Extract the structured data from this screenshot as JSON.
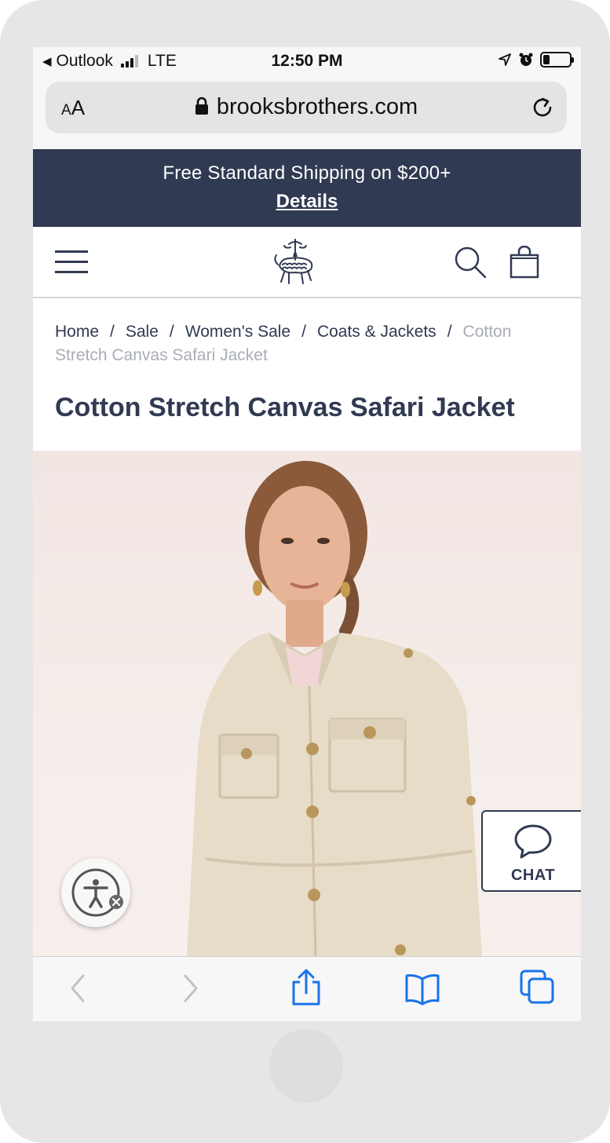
{
  "status_bar": {
    "back_app": "Outlook",
    "network": "LTE",
    "time": "12:50 PM",
    "battery_level": 0.25
  },
  "url_bar": {
    "text_size_label_small": "A",
    "text_size_label_large": "A",
    "domain": "brooksbrothers.com"
  },
  "promo": {
    "text": "Free Standard Shipping on $200+",
    "link": "Details"
  },
  "breadcrumb": {
    "items": [
      "Home",
      "Sale",
      "Women's Sale",
      "Coats & Jackets"
    ],
    "current": "Cotton Stretch Canvas Safari Jacket",
    "separator": "/"
  },
  "product": {
    "title": "Cotton Stretch Canvas Safari Jacket"
  },
  "chat": {
    "label": "CHAT"
  },
  "icons": {
    "menu": "hamburger-menu-icon",
    "search": "search-icon",
    "bag": "shopping-bag-icon",
    "logo": "golden-fleece-logo",
    "back": "chevron-left-icon",
    "forward": "chevron-right-icon",
    "share": "share-icon",
    "bookmarks": "book-icon",
    "tabs": "tabs-icon",
    "chat": "speech-bubble-icon",
    "accessibility": "accessibility-icon"
  },
  "colors": {
    "brand_navy": "#303a52",
    "ios_blue": "#1a73e8",
    "breadcrumb_current": "#a9adb5"
  }
}
